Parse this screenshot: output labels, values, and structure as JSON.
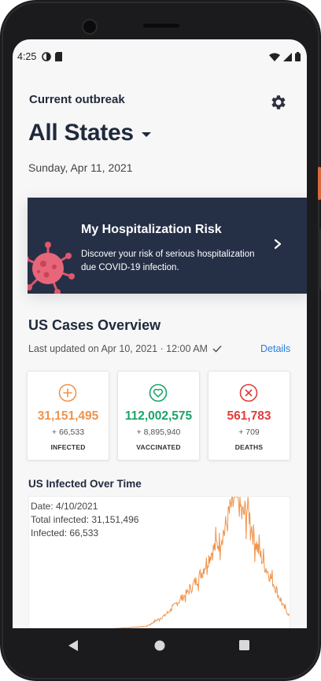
{
  "status_bar": {
    "time": "4:25"
  },
  "header": {
    "title": "Current outbreak",
    "selected_state": "All States",
    "date": "Sunday, Apr 11, 2021"
  },
  "risk_card": {
    "title": "My Hospitalization Risk",
    "description": "Discover your risk of serious hospitalization due COVID-19 infection."
  },
  "overview": {
    "title": "US Cases Overview",
    "last_updated": "Last updated on Apr 10, 2021 · 12:00 AM",
    "details_label": "Details",
    "cards": [
      {
        "value": "31,151,495",
        "delta": "+ 66,533",
        "label": "INFECTED",
        "color": "#f0934b",
        "icon": "plus-circle-icon"
      },
      {
        "value": "112,002,575",
        "delta": "+ 8,895,940",
        "label": "VACCINATED",
        "color": "#1aa36a",
        "icon": "heart-circle-icon"
      },
      {
        "value": "561,783",
        "delta": "+ 709",
        "label": "DEATHS",
        "color": "#e23b3b",
        "icon": "x-circle-icon"
      }
    ]
  },
  "chart": {
    "title": "US Infected Over Time",
    "info_date": "Date: 4/10/2021",
    "info_total": "Total infected: 31,151,496",
    "info_infected": "Infected: 66,533"
  },
  "chart_data": {
    "type": "line",
    "title": "US Infected Over Time",
    "xlabel": "",
    "ylabel": "",
    "series_color": "#f0934b",
    "x_fraction": [
      0.0,
      0.3,
      0.45,
      0.52,
      0.58,
      0.62,
      0.66,
      0.7,
      0.73,
      0.76,
      0.78,
      0.8,
      0.82,
      0.84,
      0.86,
      0.88,
      0.9,
      0.92,
      0.94,
      0.96,
      0.98,
      1.0
    ],
    "values_normalized": [
      0.0,
      0.0,
      0.02,
      0.1,
      0.22,
      0.3,
      0.42,
      0.58,
      0.66,
      0.8,
      0.96,
      1.0,
      0.86,
      0.92,
      0.72,
      0.6,
      0.5,
      0.42,
      0.34,
      0.24,
      0.16,
      0.1
    ]
  }
}
